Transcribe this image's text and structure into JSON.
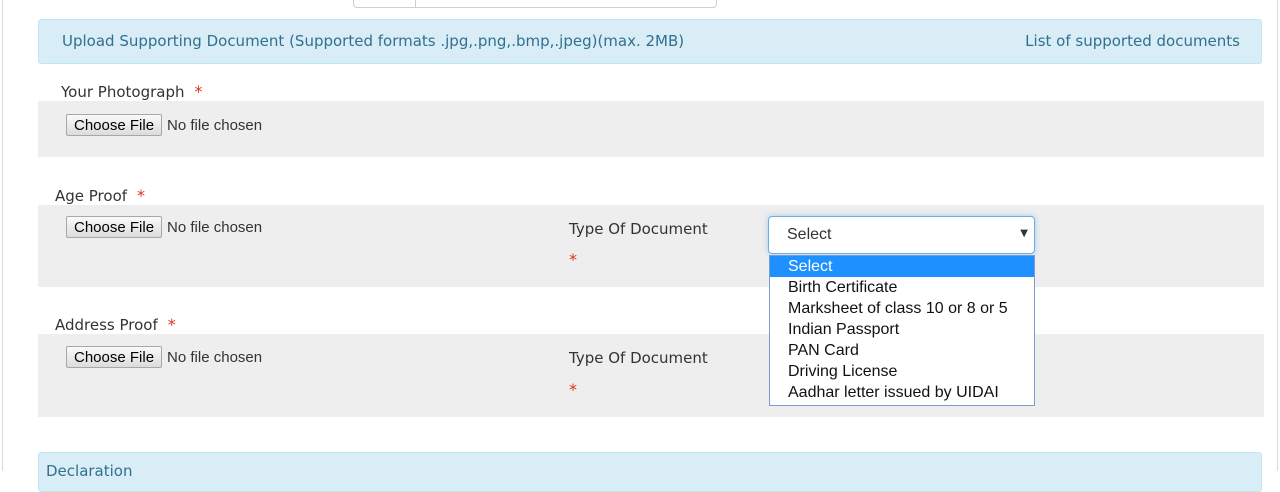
{
  "upload_section": {
    "title": "Upload Supporting Document (Supported formats .jpg,.png,.bmp,.jpeg)(max. 2MB)",
    "supported_docs_link": "List of supported documents"
  },
  "required_marker": "*",
  "fields": {
    "photograph": {
      "label": "Your Photograph",
      "button": "Choose File",
      "status": "No file chosen"
    },
    "age_proof": {
      "label": "Age Proof",
      "button": "Choose File",
      "status": "No file chosen",
      "type_label": "Type Of Document"
    },
    "address_proof": {
      "label": "Address Proof",
      "button": "Choose File",
      "status": "No file chosen",
      "type_label": "Type Of Document"
    }
  },
  "document_type_select": {
    "selected": "Select",
    "options": [
      "Select",
      "Birth Certificate",
      "Marksheet of class 10 or 8 or 5",
      "Indian Passport",
      "PAN Card",
      "Driving License",
      "Aadhar letter issued by UIDAI"
    ]
  },
  "declaration": {
    "title": "Declaration"
  },
  "colors": {
    "info_bg": "#d9edf7",
    "info_text": "#31708f",
    "required": "#e0301e",
    "option_highlight": "#1e90ff",
    "panel_bg": "#eeeeee"
  }
}
